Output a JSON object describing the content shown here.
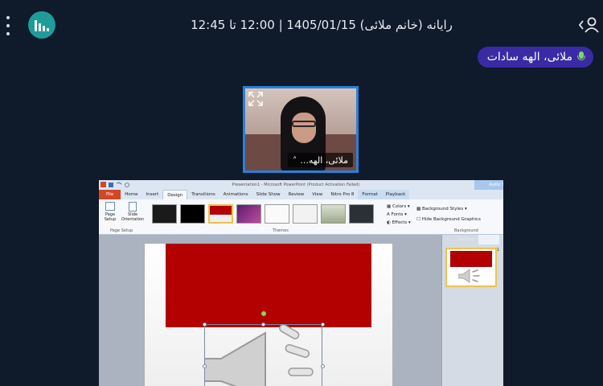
{
  "header": {
    "title": "رایانه (خانم ملائی) 1405/01/15 | 12:00 تا 12:45",
    "stats_icon": "bar-chart-icon",
    "menu_icon": "kebab-menu-icon",
    "user_icon": "user-icon"
  },
  "speaker": {
    "name": "ملائی، الهه سادات"
  },
  "camera": {
    "name": "ملائی، الهه..."
  },
  "ppt": {
    "window_title": "Presentation1 - Microsoft PowerPoint (Product Activation Failed)",
    "context_tools": "Audio Tools",
    "tabs": [
      "File",
      "Home",
      "Insert",
      "Design",
      "Transitions",
      "Animations",
      "Slide Show",
      "Review",
      "View",
      "Nitro Pro 8",
      "Format",
      "Playback"
    ],
    "page_setup": "Page Setup",
    "slide_orientation": "Slide Orientation",
    "group_page_setup": "Page Setup",
    "group_themes": "Themes",
    "group_background": "Background",
    "colors": "Colors",
    "fonts": "Fonts",
    "effects": "Effects",
    "bg_styles": "Background Styles",
    "hide_bg": "Hide Background Graphics",
    "pane_outline": "Outline",
    "pane_slides": "Slides",
    "slide_number": "1"
  },
  "colors": {
    "bg": "#0f1a2b",
    "accent": "#1f9c9a",
    "speaker_pill": "#3b2aa6",
    "mic": "#7ed957",
    "cam_border": "#2d7fd6",
    "slide_band": "#b30000"
  }
}
